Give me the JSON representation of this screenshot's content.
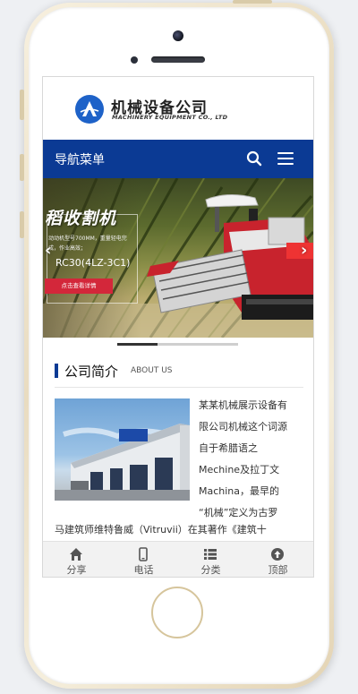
{
  "header": {
    "logo_title": "机械设备公司",
    "logo_subtitle": "MACHINERY EQUIPMENT CO., LTD"
  },
  "nav": {
    "title": "导航菜单"
  },
  "banner": {
    "headline": "稻收割机",
    "small_text": "动动机型号700MM，重量轻电完成，作业高效；",
    "model": "RC30(4LZ-3C1)",
    "button_label": "点击查看详情",
    "slide_progress": 0.33
  },
  "section": {
    "title": "公司简介",
    "subtitle": "ABOUT US",
    "intro_lines": [
      "某某机械展示设备有",
      "限公司机械这个词源",
      "自于希腊语之",
      "Mechine及拉丁文",
      "Machina，最早的",
      "“机械”定义为古罗"
    ],
    "intro_tail": "马建筑师维特鲁威（Vitruvii）在其著作《建筑十"
  },
  "footer": {
    "items": [
      {
        "label": "分享",
        "icon": "home-icon"
      },
      {
        "label": "电话",
        "icon": "phone-icon"
      },
      {
        "label": "分类",
        "icon": "list-icon"
      },
      {
        "label": "顶部",
        "icon": "arrow-up-circle-icon"
      }
    ]
  },
  "colors": {
    "nav_bg": "#0b3a94",
    "logo_blue": "#1e62c8",
    "banner_button": "#d3273a",
    "frame_gold": "#e9dcc0"
  }
}
